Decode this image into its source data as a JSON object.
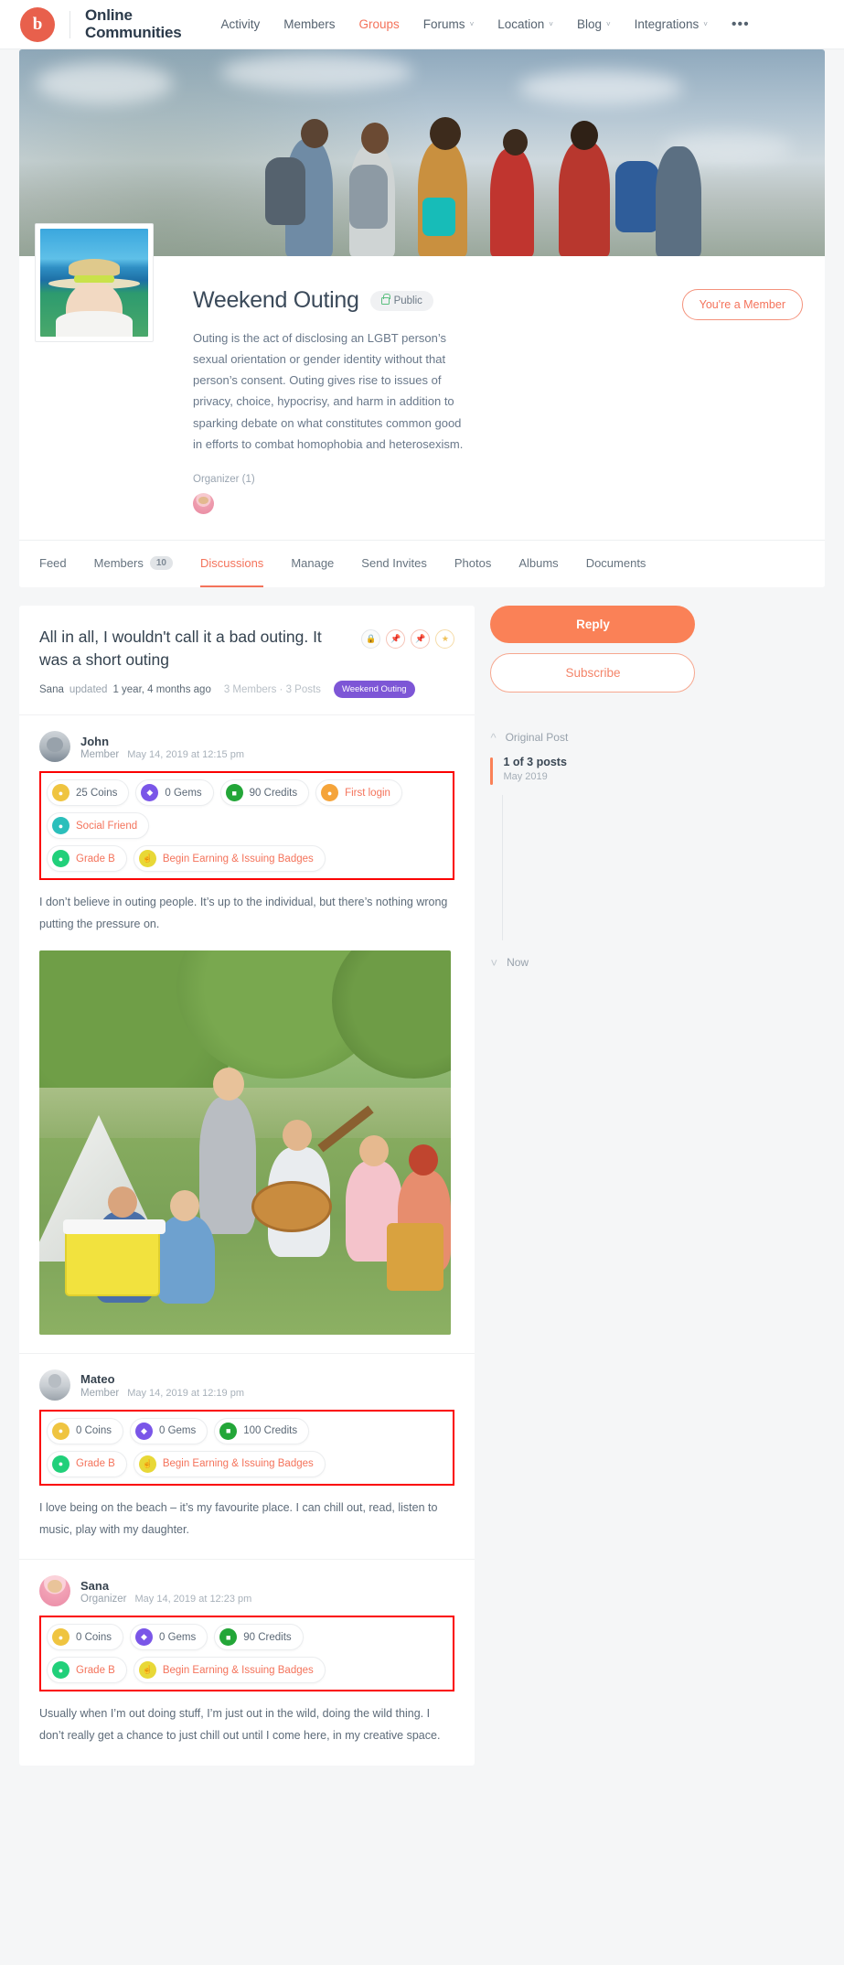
{
  "header": {
    "brand_name_line1": "Online",
    "brand_name_line2": "Communities",
    "logo_glyph": "b",
    "nav": [
      {
        "label": "Activity",
        "caret": "",
        "active": false
      },
      {
        "label": "Members",
        "caret": "",
        "active": false
      },
      {
        "label": "Groups",
        "caret": "",
        "active": true
      },
      {
        "label": "Forums",
        "caret": "˅",
        "active": false
      },
      {
        "label": "Location",
        "caret": "˅",
        "active": false
      },
      {
        "label": "Blog",
        "caret": "˅",
        "active": false
      },
      {
        "label": "Integrations",
        "caret": "˅",
        "active": false
      }
    ],
    "more_label": "•••"
  },
  "group": {
    "title": "Weekend Outing",
    "privacy": "Public",
    "description": "Outing is the act of disclosing an LGBT person’s sexual orientation or gender identity without that person’s consent. Outing gives rise to issues of privacy, choice, hypocrisy, and harm in addition to sparking debate on what constitutes common good in efforts to combat homophobia and heterosexism.",
    "organizer_label": "Organizer (1)",
    "membership_button": "You're a Member"
  },
  "tabs": [
    {
      "label": "Feed",
      "count": "",
      "active": false
    },
    {
      "label": "Members",
      "count": "10",
      "active": false
    },
    {
      "label": "Discussions",
      "count": "",
      "active": true
    },
    {
      "label": "Manage",
      "count": "",
      "active": false
    },
    {
      "label": "Send Invites",
      "count": "",
      "active": false
    },
    {
      "label": "Photos",
      "count": "",
      "active": false
    },
    {
      "label": "Albums",
      "count": "",
      "active": false
    },
    {
      "label": "Documents",
      "count": "",
      "active": false
    }
  ],
  "thread": {
    "title": "All in all, I wouldn't call it a bad outing. It was a short outing",
    "author": "Sana",
    "updated_label": "updated",
    "updated_time": "1 year, 4 months ago",
    "members_posts": "3 Members · 3 Posts",
    "tag": "Weekend Outing",
    "icons": [
      "lock-icon",
      "pin-icon",
      "unpin-icon",
      "star-icon"
    ]
  },
  "posts": [
    {
      "name": "John",
      "role": "Member",
      "date": "May 14, 2019 at 12:15 pm",
      "avatar": "av-john",
      "badges_row1": [
        {
          "label": "25 Coins",
          "icon": "coin",
          "accent": false,
          "glyph": "●"
        },
        {
          "label": "0 Gems",
          "icon": "gem",
          "accent": false,
          "glyph": "◆"
        },
        {
          "label": "90 Credits",
          "icon": "credit",
          "accent": false,
          "glyph": "■"
        },
        {
          "label": "First login",
          "icon": "login",
          "accent": true,
          "glyph": "●"
        },
        {
          "label": "Social Friend",
          "icon": "social",
          "accent": true,
          "glyph": "●"
        }
      ],
      "badges_row2": [
        {
          "label": "Grade B",
          "icon": "grade",
          "accent": true,
          "glyph": "●"
        },
        {
          "label": "Begin Earning & Issuing Badges",
          "icon": "begin",
          "accent": true,
          "glyph": "☝"
        }
      ],
      "text": "I don’t believe in outing people. It’s up to the individual, but there’s nothing wrong putting the pressure on.",
      "has_photo": true
    },
    {
      "name": "Mateo",
      "role": "Member",
      "date": "May 14, 2019 at 12:19 pm",
      "avatar": "av-mateo",
      "badges_row1": [
        {
          "label": "0 Coins",
          "icon": "coin",
          "accent": false,
          "glyph": "●"
        },
        {
          "label": "0 Gems",
          "icon": "gem",
          "accent": false,
          "glyph": "◆"
        },
        {
          "label": "100 Credits",
          "icon": "credit",
          "accent": false,
          "glyph": "■"
        }
      ],
      "badges_row2": [
        {
          "label": "Grade B",
          "icon": "grade",
          "accent": true,
          "glyph": "●"
        },
        {
          "label": "Begin Earning & Issuing Badges",
          "icon": "begin",
          "accent": true,
          "glyph": "☝"
        }
      ],
      "text": "I love being on the beach – it’s my favourite place. I can chill out, read, listen to music, play with my daughter.",
      "has_photo": false
    },
    {
      "name": "Sana",
      "role": "Organizer",
      "date": "May 14, 2019 at 12:23 pm",
      "avatar": "av-sana",
      "badges_row1": [
        {
          "label": "0 Coins",
          "icon": "coin",
          "accent": false,
          "glyph": "●"
        },
        {
          "label": "0 Gems",
          "icon": "gem",
          "accent": false,
          "glyph": "◆"
        },
        {
          "label": "90 Credits",
          "icon": "credit",
          "accent": false,
          "glyph": "■"
        }
      ],
      "badges_row2": [
        {
          "label": "Grade B",
          "icon": "grade",
          "accent": true,
          "glyph": "●"
        },
        {
          "label": "Begin Earning & Issuing Badges",
          "icon": "begin",
          "accent": true,
          "glyph": "☝"
        }
      ],
      "text": "Usually when I’m out doing stuff, I’m just out in the wild, doing the wild thing. I don’t really get a chance to just chill out until I come here, in my creative space.",
      "has_photo": false
    }
  ],
  "sidebar": {
    "reply_button": "Reply",
    "subscribe_button": "Subscribe",
    "original_post_label": "Original Post",
    "post_counter": "1 of 3 posts",
    "post_date": "May 2019",
    "now_label": "Now"
  },
  "colors": {
    "accent": "#f4735b",
    "reply_button": "#fa8157",
    "tag_purple": "#7d56d6",
    "highlight_outline": "#fb0000"
  }
}
